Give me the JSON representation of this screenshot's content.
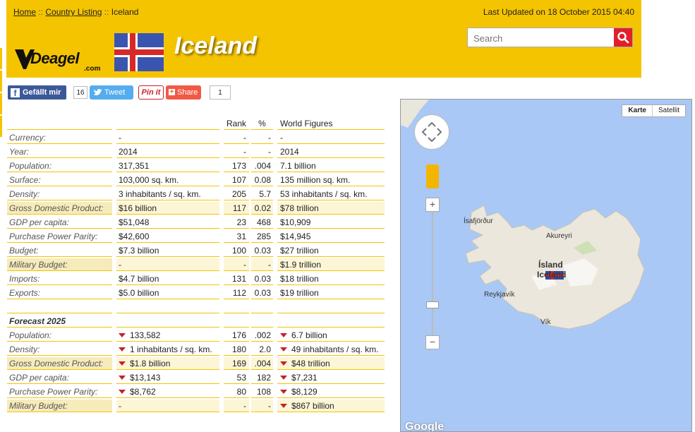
{
  "breadcrumb": {
    "home": "Home",
    "sep": "::",
    "listing": "Country Listing",
    "current": "Iceland"
  },
  "last_updated": "Last Updated on 18 October 2015 04:40",
  "search": {
    "placeholder": "Search"
  },
  "logo": {
    "word": "Deagel",
    "com": ".com"
  },
  "page_title": "Iceland",
  "social": {
    "facebook_label": "Gefällt mir",
    "facebook_count": "16",
    "tweet_label": "Tweet",
    "pinit_label": "Pin it",
    "share_label": "Share",
    "share_count": "1"
  },
  "table": {
    "headers": [
      "",
      "",
      "Rank",
      "%",
      "World Figures"
    ],
    "rows": [
      {
        "label": "Currency:",
        "value": "-",
        "rank": "-",
        "pct": "-",
        "world": "-",
        "hl": false
      },
      {
        "label": "Year:",
        "value": "2014",
        "rank": "-",
        "pct": "-",
        "world": "2014",
        "hl": false
      },
      {
        "label": "Population:",
        "value": "317,351",
        "rank": "173",
        "pct": ".004",
        "world": "7.1 billion",
        "hl": false
      },
      {
        "label": "Surface:",
        "value": "103,000 sq. km.",
        "rank": "107",
        "pct": "0.08",
        "world": "135 million sq. km.",
        "hl": false
      },
      {
        "label": "Density:",
        "value": "3 inhabitants / sq. km.",
        "rank": "205",
        "pct": "5.7",
        "world": "53 inhabitants / sq. km.",
        "hl": false
      },
      {
        "label": "Gross Domestic Product:",
        "value": "$16 billion",
        "rank": "117",
        "pct": "0.02",
        "world": "$78 trillion",
        "hl": true
      },
      {
        "label": "GDP per capita:",
        "value": "$51,048",
        "rank": "23",
        "pct": "468",
        "world": "$10,909",
        "hl": false
      },
      {
        "label": "Purchase Power Parity:",
        "value": "$42,600",
        "rank": "31",
        "pct": "285",
        "world": "$14,945",
        "hl": false
      },
      {
        "label": "Budget:",
        "value": "$7.3 billion",
        "rank": "100",
        "pct": "0.03",
        "world": "$27 trillion",
        "hl": false
      },
      {
        "label": "Military Budget:",
        "value": "-",
        "rank": "-",
        "pct": "-",
        "world": "$1.9 trillion",
        "hl": true
      },
      {
        "label": "Imports:",
        "value": "$4.7 billion",
        "rank": "131",
        "pct": "0.03",
        "world": "$18 trillion",
        "hl": false
      },
      {
        "label": "Exports:",
        "value": "$5.0 billion",
        "rank": "112",
        "pct": "0.03",
        "world": "$19 trillion",
        "hl": false
      }
    ],
    "forecast_title": "Forecast 2025",
    "forecast_rows": [
      {
        "label": "Population:",
        "value": "133,582",
        "rank": "176",
        "pct": ".002",
        "world": "6.7 billion",
        "hl": false,
        "down": true,
        "wdown": true
      },
      {
        "label": "Density:",
        "value": "1 inhabitants / sq. km.",
        "rank": "180",
        "pct": "2.0",
        "world": "49 inhabitants / sq. km.",
        "hl": false,
        "down": true,
        "wdown": true
      },
      {
        "label": "Gross Domestic Product:",
        "value": "$1.8 billion",
        "rank": "169",
        "pct": ".004",
        "world": "$48 trillion",
        "hl": true,
        "down": true,
        "wdown": true
      },
      {
        "label": "GDP per capita:",
        "value": "$13,143",
        "rank": "53",
        "pct": "182",
        "world": "$7,231",
        "hl": false,
        "down": true,
        "wdown": true
      },
      {
        "label": "Purchase Power Parity:",
        "value": "$8,762",
        "rank": "80",
        "pct": "108",
        "world": "$8,129",
        "hl": false,
        "down": true,
        "wdown": true
      },
      {
        "label": "Military Budget:",
        "value": "-",
        "rank": "-",
        "pct": "-",
        "world": "$867 billion",
        "hl": true,
        "down": false,
        "wdown": true
      }
    ]
  },
  "map": {
    "type_map": "Karte",
    "type_satellite": "Satellit",
    "labels": {
      "isafjordur": "Ísafjörður",
      "akureyri": "Akureyri",
      "island": "Ísland",
      "iceland": "Iceland",
      "reykjavik": "Reykjavík",
      "vik": "Vík"
    },
    "google": "Google"
  },
  "colors": {
    "brand_yellow": "#f5c400",
    "search_red": "#e0202a",
    "down_arrow": "#c0242b"
  }
}
